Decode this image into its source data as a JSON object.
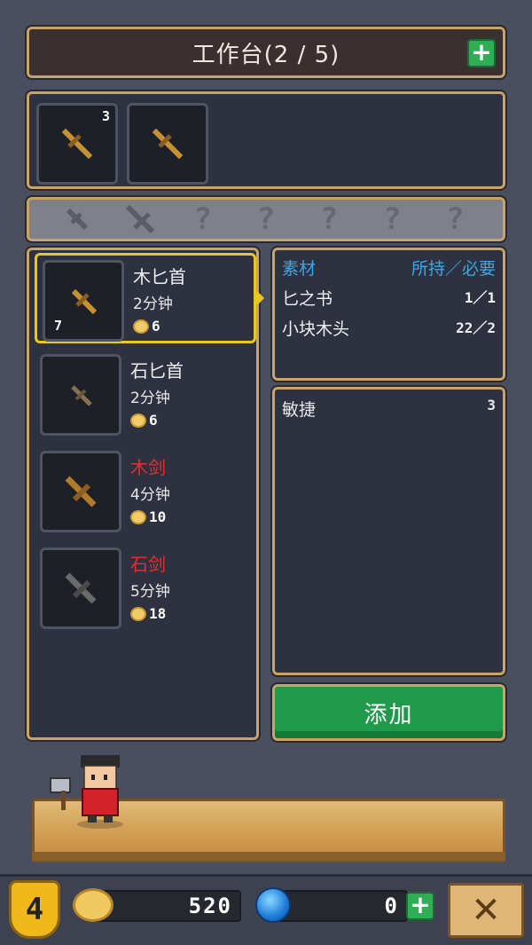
{
  "header": {
    "title": "工作台(2 / 5)",
    "add_icon": "plus-icon"
  },
  "queue": [
    {
      "icon": "dagger-icon",
      "count": "3",
      "color": "#c89030"
    },
    {
      "icon": "dagger-icon",
      "count": "",
      "color": "#c89030"
    }
  ],
  "unknown_strip": [
    "dagger-silhouette-icon",
    "sword-silhouette-icon",
    "?",
    "?",
    "?",
    "?",
    "?"
  ],
  "recipes": [
    {
      "name": "木匕首",
      "time": "2分钟",
      "cost": "6",
      "owned": "7",
      "locked": false,
      "icon_color": "#c89030"
    },
    {
      "name": "石匕首",
      "time": "2分钟",
      "cost": "6",
      "owned": "",
      "locked": false,
      "icon_color": "#8a7050"
    },
    {
      "name": "木剑",
      "time": "4分钟",
      "cost": "10",
      "owned": "",
      "locked": true,
      "icon_color": "#b07a28"
    },
    {
      "name": "石剑",
      "time": "5分钟",
      "cost": "18",
      "owned": "",
      "locked": true,
      "icon_color": "#6a6a6a"
    }
  ],
  "materials": {
    "header_left": "素材",
    "header_right": "所持／必要",
    "rows": [
      {
        "name": "匕之书",
        "qty": "1／1"
      },
      {
        "name": "小块木头",
        "qty": "22／2"
      }
    ]
  },
  "stats": {
    "name": "敏捷",
    "value": "3"
  },
  "add_button": "添加",
  "bottom": {
    "level": "4",
    "gold": "520",
    "gems": "0"
  },
  "colors": {
    "accent_green": "#1f9a4a",
    "frame": "#c9a46a",
    "selection": "#e8c820",
    "locked_text": "#e03030",
    "material_header": "#3aa8e8"
  }
}
